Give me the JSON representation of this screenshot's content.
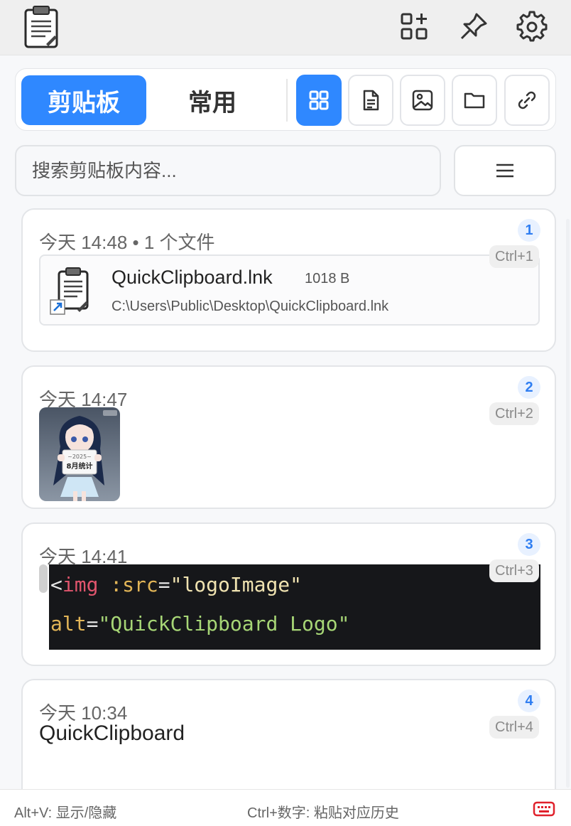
{
  "app": {
    "icon": "clipboard-icon",
    "toolbar_icons": [
      "quick-add-icon",
      "pin-icon",
      "gear-icon"
    ]
  },
  "tabs": {
    "clipboard": "剪贴板",
    "favorites": "常用"
  },
  "filters": [
    {
      "icon": "grid-icon",
      "active": true
    },
    {
      "icon": "document-icon",
      "active": false
    },
    {
      "icon": "image-icon",
      "active": false
    },
    {
      "icon": "folder-icon",
      "active": false
    },
    {
      "icon": "link-icon",
      "active": false
    }
  ],
  "search": {
    "placeholder": "搜索剪贴板内容...",
    "value": ""
  },
  "menu_icon": "menu-icon",
  "items": [
    {
      "meta": "今天 14:48 • 1 个文件",
      "num": "1",
      "shortcut": "Ctrl+1",
      "file": {
        "name": "QuickClipboard.lnk",
        "size": "1018 B",
        "path": "C:\\Users\\Public\\Desktop\\QuickClipboard.lnk"
      }
    },
    {
      "meta": "今天 14:47",
      "num": "2",
      "shortcut": "Ctrl+2",
      "image": {
        "sign_top": "~2025~",
        "sign_bottom": "8月统计"
      }
    },
    {
      "meta": "今天 14:41",
      "num": "3",
      "shortcut": "Ctrl+3",
      "code": {
        "l1_open": "<",
        "l1_tag": "img",
        "l1_sp": " ",
        "l1_attr": ":src",
        "l1_eq": "=",
        "l1_val": "\"logoImage\"",
        "l2_attr": "alt",
        "l2_eq": "=",
        "l2_val": "\"QuickClipboard Logo\""
      }
    },
    {
      "meta": "今天 10:34",
      "num": "4",
      "shortcut": "Ctrl+4",
      "text": "QuickClipboard"
    }
  ],
  "footer": {
    "left": "Alt+V: 显示/隐藏",
    "center": "Ctrl+数字: 粘贴对应历史",
    "keyboard_icon": "keyboard-icon",
    "keyboard_color": "#e0212b"
  },
  "colors": {
    "accent": "#2f88ff"
  }
}
